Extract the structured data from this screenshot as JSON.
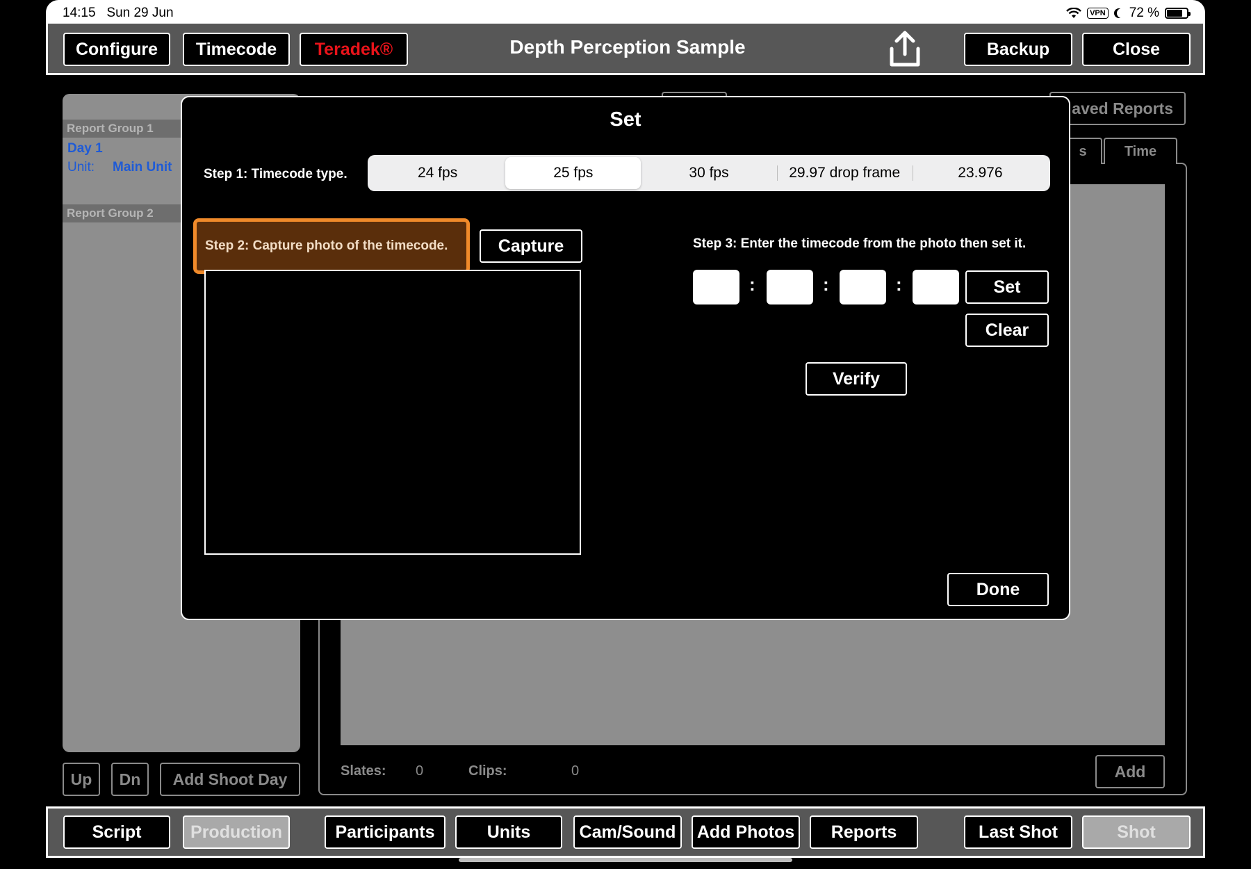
{
  "status": {
    "time": "14:15",
    "date": "Sun 29 Jun",
    "vpn": "VPN",
    "battery": "72 %"
  },
  "topbar": {
    "configure": "Configure",
    "timecode": "Timecode",
    "teradek": "Teradek®",
    "title": "Depth Perception Sample",
    "backup": "Backup",
    "close": "Close"
  },
  "background": {
    "report_group_1": "Report Group 1",
    "day1": "Day 1",
    "unit_label": "Unit:",
    "unit_value": "Main Unit",
    "report_group_2": "Report Group 2",
    "saved_reports": "aved Reports",
    "tab_partial": "s",
    "tab_time": "Time",
    "up": "Up",
    "dn": "Dn",
    "add_shoot_day": "Add Shoot Day",
    "slates_label": "Slates:",
    "slates_value": "0",
    "clips_label": "Clips:",
    "clips_value": "0",
    "add": "Add"
  },
  "bottombar": {
    "script": "Script",
    "production": "Production",
    "participants": "Participants",
    "units": "Units",
    "cam_sound": "Cam/Sound",
    "add_photos": "Add Photos",
    "reports": "Reports",
    "last_shot": "Last Shot",
    "shot": "Shot"
  },
  "modal": {
    "title": "Set",
    "step1": "Step 1: Timecode type.",
    "fps_options": [
      "24 fps",
      "25 fps",
      "30 fps",
      "29.97 drop frame",
      "23.976"
    ],
    "selected_fps": "25 fps",
    "step2": "Step 2: Capture photo of the timecode.",
    "capture": "Capture",
    "step3": "Step 3: Enter the timecode from the photo then set it.",
    "timecode_fields": [
      "",
      "",
      "",
      ""
    ],
    "separator": ":",
    "set": "Set",
    "clear": "Clear",
    "verify": "Verify",
    "done": "Done"
  },
  "colors": {
    "accent_orange": "#f08a2a",
    "step2_bg": "#5a2e0b",
    "teradek_red": "#e8131a",
    "link_blue": "#1f5bd6"
  }
}
